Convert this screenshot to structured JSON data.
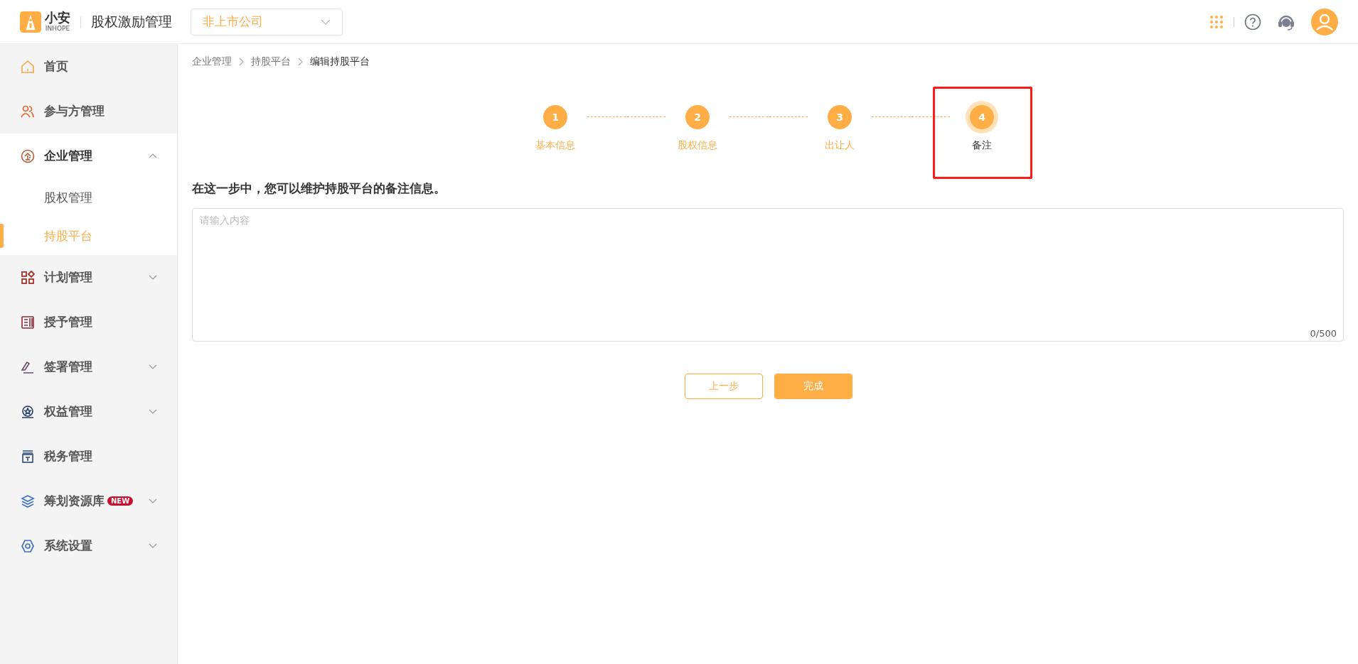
{
  "header": {
    "logo_text": "小安",
    "logo_sub": "INHOPE",
    "app_title": "股权激励管理",
    "company_select": {
      "value": "非上市公司"
    }
  },
  "sidebar": {
    "items": [
      {
        "label": "首页"
      },
      {
        "label": "参与方管理"
      },
      {
        "label": "企业管理",
        "expanded": true,
        "children": [
          {
            "label": "股权管理",
            "selected": false
          },
          {
            "label": "持股平台",
            "selected": true
          }
        ]
      },
      {
        "label": "计划管理",
        "expanded": false
      },
      {
        "label": "授予管理"
      },
      {
        "label": "签署管理",
        "expanded": false
      },
      {
        "label": "权益管理",
        "expanded": false
      },
      {
        "label": "税务管理"
      },
      {
        "label": "筹划资源库",
        "badge": "NEW",
        "expanded": false
      },
      {
        "label": "系统设置",
        "expanded": false
      }
    ]
  },
  "breadcrumb": [
    "企业管理",
    "持股平台",
    "编辑持股平台"
  ],
  "steps": [
    {
      "number": "1",
      "label": "基本信息",
      "selected": false
    },
    {
      "number": "2",
      "label": "股权信息",
      "selected": false
    },
    {
      "number": "3",
      "label": "出让人",
      "selected": false
    },
    {
      "number": "4",
      "label": "备注",
      "selected": true
    }
  ],
  "instruction": "在这一步中，您可以维护持股平台的备注信息。",
  "remark_field": {
    "placeholder": "请输入内容",
    "counter": "0/500"
  },
  "buttons": {
    "previous": "上一步",
    "finish": "完成"
  }
}
